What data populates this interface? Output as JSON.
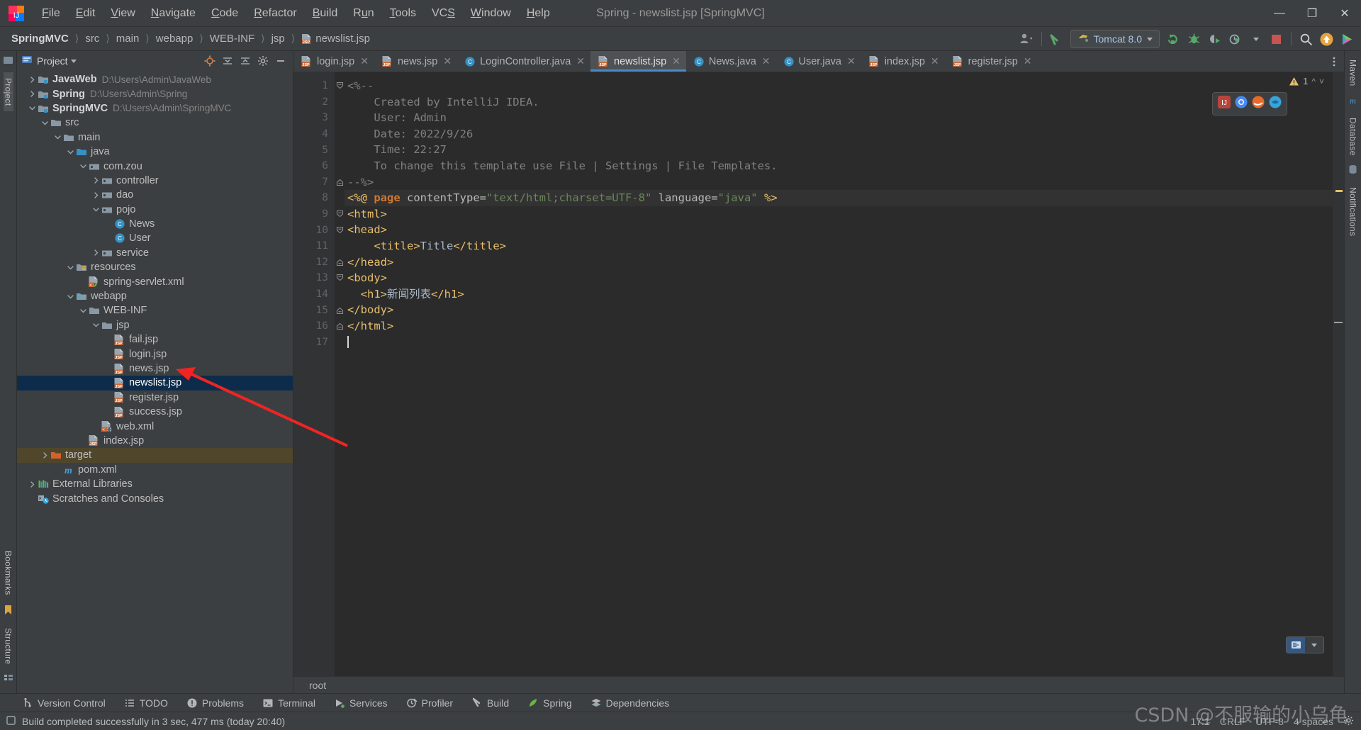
{
  "window": {
    "title": "Spring - newslist.jsp [SpringMVC]",
    "minimize_label": "—",
    "maximize_label": "❐",
    "close_label": "✕"
  },
  "menu": {
    "items": [
      {
        "label": "File",
        "mnemonic": "F"
      },
      {
        "label": "Edit",
        "mnemonic": "E"
      },
      {
        "label": "View",
        "mnemonic": "V"
      },
      {
        "label": "Navigate",
        "mnemonic": "N"
      },
      {
        "label": "Code",
        "mnemonic": "C"
      },
      {
        "label": "Refactor",
        "mnemonic": "R"
      },
      {
        "label": "Build",
        "mnemonic": "B"
      },
      {
        "label": "Run",
        "mnemonic": "u"
      },
      {
        "label": "Tools",
        "mnemonic": "T"
      },
      {
        "label": "VCS",
        "mnemonic": "S"
      },
      {
        "label": "Window",
        "mnemonic": "W"
      },
      {
        "label": "Help",
        "mnemonic": "H"
      }
    ]
  },
  "breadcrumbs": {
    "items": [
      "SpringMVC",
      "src",
      "main",
      "webapp",
      "WEB-INF",
      "jsp",
      "newslist.jsp"
    ],
    "separator": "›"
  },
  "toolbar": {
    "run_config": "Tomcat 8.0",
    "icons": [
      "account-icon",
      "updates-arrow-icon",
      "tomcat-icon",
      "chevron-down-icon",
      "rerun-icon",
      "debug-icon",
      "run-with-coverage-icon",
      "profiler-icon",
      "stop-icon",
      "search-icon",
      "update-project-icon",
      "ide-assistant-icon"
    ]
  },
  "project_panel": {
    "title": "Project",
    "header_icons": [
      "locate-icon",
      "expand-all-icon",
      "collapse-all-icon",
      "settings-icon",
      "hide-icon"
    ],
    "tree": [
      {
        "label": "JavaWeb",
        "path": "D:\\Users\\Admin\\JavaWeb",
        "indent": 0,
        "arrow": "right",
        "icon": "module-icon",
        "bold": true
      },
      {
        "label": "Spring",
        "path": "D:\\Users\\Admin\\Spring",
        "indent": 0,
        "arrow": "right",
        "icon": "module-icon",
        "bold": true
      },
      {
        "label": "SpringMVC",
        "path": "D:\\Users\\Admin\\SpringMVC",
        "indent": 0,
        "arrow": "down",
        "icon": "module-icon",
        "bold": true
      },
      {
        "label": "src",
        "path": "",
        "indent": 1,
        "arrow": "down",
        "icon": "folder-icon",
        "bold": false
      },
      {
        "label": "main",
        "path": "",
        "indent": 2,
        "arrow": "down",
        "icon": "folder-icon",
        "bold": false
      },
      {
        "label": "java",
        "path": "",
        "indent": 3,
        "arrow": "down",
        "icon": "source-folder-icon",
        "bold": false
      },
      {
        "label": "com.zou",
        "path": "",
        "indent": 4,
        "arrow": "down",
        "icon": "package-icon",
        "bold": false
      },
      {
        "label": "controller",
        "path": "",
        "indent": 5,
        "arrow": "right",
        "icon": "package-icon",
        "bold": false
      },
      {
        "label": "dao",
        "path": "",
        "indent": 5,
        "arrow": "right",
        "icon": "package-icon",
        "bold": false
      },
      {
        "label": "pojo",
        "path": "",
        "indent": 5,
        "arrow": "down",
        "icon": "package-icon",
        "bold": false
      },
      {
        "label": "News",
        "path": "",
        "indent": 6,
        "arrow": "none",
        "icon": "class-icon",
        "bold": false
      },
      {
        "label": "User",
        "path": "",
        "indent": 6,
        "arrow": "none",
        "icon": "class-icon",
        "bold": false
      },
      {
        "label": "service",
        "path": "",
        "indent": 5,
        "arrow": "right",
        "icon": "package-icon",
        "bold": false
      },
      {
        "label": "resources",
        "path": "",
        "indent": 3,
        "arrow": "down",
        "icon": "resources-folder-icon",
        "bold": false
      },
      {
        "label": "spring-servlet.xml",
        "path": "",
        "indent": 4,
        "arrow": "none",
        "icon": "spring-xml-icon",
        "bold": false
      },
      {
        "label": "webapp",
        "path": "",
        "indent": 3,
        "arrow": "down",
        "icon": "webapp-folder-icon",
        "bold": false
      },
      {
        "label": "WEB-INF",
        "path": "",
        "indent": 4,
        "arrow": "down",
        "icon": "folder-icon",
        "bold": false
      },
      {
        "label": "jsp",
        "path": "",
        "indent": 5,
        "arrow": "down",
        "icon": "folder-icon",
        "bold": false
      },
      {
        "label": "fail.jsp",
        "path": "",
        "indent": 6,
        "arrow": "none",
        "icon": "jsp-icon",
        "bold": false
      },
      {
        "label": "login.jsp",
        "path": "",
        "indent": 6,
        "arrow": "none",
        "icon": "jsp-icon",
        "bold": false
      },
      {
        "label": "news.jsp",
        "path": "",
        "indent": 6,
        "arrow": "none",
        "icon": "jsp-icon",
        "bold": false
      },
      {
        "label": "newslist.jsp",
        "path": "",
        "indent": 6,
        "arrow": "none",
        "icon": "jsp-icon",
        "bold": false,
        "selected": true
      },
      {
        "label": "register.jsp",
        "path": "",
        "indent": 6,
        "arrow": "none",
        "icon": "jsp-icon",
        "bold": false
      },
      {
        "label": "success.jsp",
        "path": "",
        "indent": 6,
        "arrow": "none",
        "icon": "jsp-icon",
        "bold": false
      },
      {
        "label": "web.xml",
        "path": "",
        "indent": 5,
        "arrow": "none",
        "icon": "web-xml-icon",
        "bold": false
      },
      {
        "label": "index.jsp",
        "path": "",
        "indent": 4,
        "arrow": "none",
        "icon": "jsp-icon",
        "bold": false
      },
      {
        "label": "target",
        "path": "",
        "indent": 1,
        "arrow": "right",
        "icon": "excluded-folder-icon",
        "bold": false,
        "excluded": true
      },
      {
        "label": "pom.xml",
        "path": "",
        "indent": 2,
        "arrow": "none",
        "icon": "maven-icon",
        "bold": false
      },
      {
        "label": "External Libraries",
        "path": "",
        "indent": 0,
        "arrow": "right",
        "icon": "libraries-icon",
        "bold": false
      },
      {
        "label": "Scratches and Consoles",
        "path": "",
        "indent": 0,
        "arrow": "none",
        "icon": "scratches-icon",
        "bold": false
      }
    ]
  },
  "editor_tabs": [
    {
      "label": "login.jsp",
      "icon": "jsp-icon",
      "active": false
    },
    {
      "label": "news.jsp",
      "icon": "jsp-icon",
      "active": false
    },
    {
      "label": "LoginController.java",
      "icon": "class-icon",
      "active": false
    },
    {
      "label": "newslist.jsp",
      "icon": "jsp-icon",
      "active": true
    },
    {
      "label": "News.java",
      "icon": "class-icon",
      "active": false
    },
    {
      "label": "User.java",
      "icon": "class-icon",
      "active": false
    },
    {
      "label": "index.jsp",
      "icon": "jsp-icon",
      "active": false
    },
    {
      "label": "register.jsp",
      "icon": "jsp-icon",
      "active": false
    }
  ],
  "editor": {
    "warning_count": "1",
    "line_numbers": [
      "1",
      "2",
      "3",
      "4",
      "5",
      "6",
      "7",
      "8",
      "9",
      "10",
      "11",
      "12",
      "13",
      "14",
      "15",
      "16",
      "17"
    ],
    "lines": [
      "<%--",
      "    Created by IntelliJ IDEA.",
      "    User: Admin",
      "    Date: 2022/9/26",
      "    Time: 22:27",
      "    To change this template use File | Settings | File Templates.",
      "--%>",
      "<%@ page contentType=\"text/html;charset=UTF-8\" language=\"java\" %>",
      "<html>",
      "<head>",
      "    <title>Title</title>",
      "</head>",
      "<body>",
      "  <h1>新闻列表</h1>",
      "</body>",
      "</html>",
      ""
    ],
    "breadcrumb_bottom": "root"
  },
  "tool_window_bar": [
    {
      "label": "Version Control",
      "icon": "branch-icon"
    },
    {
      "label": "TODO",
      "icon": "todo-icon"
    },
    {
      "label": "Problems",
      "icon": "problems-icon"
    },
    {
      "label": "Terminal",
      "icon": "terminal-icon"
    },
    {
      "label": "Services",
      "icon": "services-icon"
    },
    {
      "label": "Profiler",
      "icon": "profiler-icon"
    },
    {
      "label": "Build",
      "icon": "build-icon"
    },
    {
      "label": "Spring",
      "icon": "spring-icon"
    },
    {
      "label": "Dependencies",
      "icon": "dependencies-icon"
    }
  ],
  "left_rail": {
    "top": [
      "Project"
    ],
    "bottom": [
      "Bookmarks",
      "Structure"
    ]
  },
  "right_rail": {
    "top": [
      "Maven",
      "Database",
      "Notifications"
    ]
  },
  "status": {
    "message": "Build completed successfully in 3 sec, 477 ms (today 20:40)",
    "caret_position": "17:1",
    "line_separator": "CRLF",
    "encoding": "UTF-8",
    "indent": "4 spaces"
  },
  "watermark": "CSDN @不服输的小乌龟",
  "colors": {
    "accent": "#4a88c7",
    "selection": "#0d2c4b",
    "excluded": "#50462b",
    "jsp_orange": "#cc6733",
    "class_blue": "#3592c4",
    "annotation_red": "#f02424"
  }
}
